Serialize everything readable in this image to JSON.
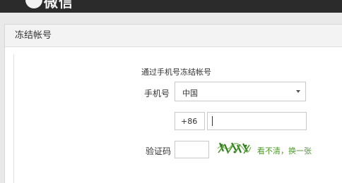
{
  "app": {
    "title": "微信"
  },
  "page": {
    "header_title": "冻结帐号",
    "subtitle": "通过手机号冻结帐号"
  },
  "form": {
    "phone_label": "手机号",
    "country_value": "中国",
    "country_code": "+86",
    "phone_value": "",
    "captcha_label": "验证码",
    "captcha_value": "",
    "refresh_link": "看不清，换一张"
  },
  "colors": {
    "topbar": "#2b2b2b",
    "link_green": "#4c9a2a",
    "border": "#c9c9c9"
  },
  "icons": {
    "brand": "wechat-logo-icon",
    "dropdown": "chevron-down-icon"
  }
}
